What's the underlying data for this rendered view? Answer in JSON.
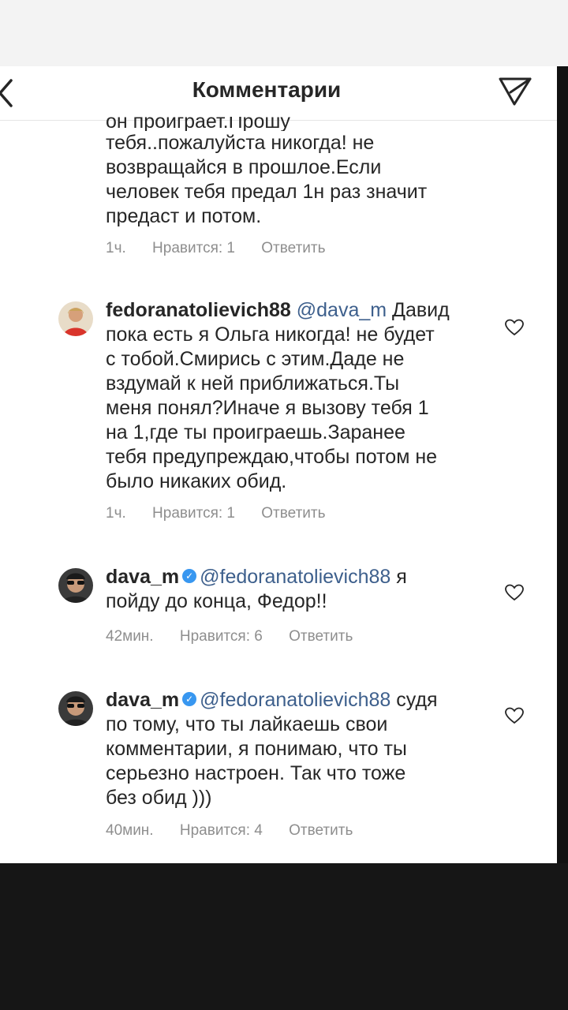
{
  "header": {
    "title": "Комментарии"
  },
  "partial_comment": {
    "cut_line": "он проиграет.Прошу",
    "lines": [
      "тебя..пожалуйста никогда! не",
      "возвращайся в прошлое.Если",
      "человек тебя предал 1н раз значит",
      "предаст и потом."
    ],
    "time": "1ч.",
    "likes": "Нравится: 1",
    "reply": "Ответить"
  },
  "comments": [
    {
      "username": "fedoranatolievich88",
      "mention": "@dava_m",
      "line1_rest": "Давид",
      "lines": [
        "пока есть я Ольга никогда! не будет",
        "с тобой.Смирись с этим.Даде не",
        "вздумай к ней приближаться.Ты",
        "меня понял?Иначе я вызову тебя 1",
        "на 1,где ты проиграешь.Заранее",
        "тебя предупреждаю,чтобы потом не",
        "было никаких обид."
      ],
      "time": "1ч.",
      "likes": "Нравится: 1",
      "reply": "Ответить"
    },
    {
      "username": "dava_m",
      "mention": "@fedoranatolievich88",
      "line1_rest": "я",
      "lines": [
        "пойду до конца, Федор!!"
      ],
      "time": "42мин.",
      "likes": "Нравится: 6",
      "reply": "Ответить"
    },
    {
      "username": "dava_m",
      "mention": "@fedoranatolievich88",
      "line1_rest": "судя",
      "lines": [
        "по тому, что ты лайкаешь свои",
        "комментарии, я понимаю, что ты",
        "серьезно настроен. Так что тоже",
        "без обид )))"
      ],
      "time": "40мин.",
      "likes": "Нравится: 4",
      "reply": "Ответить"
    }
  ],
  "colors": {
    "text": "#262626",
    "meta": "#8e8e8e",
    "mention": "#3d5f8c",
    "verified": "#3897f0"
  }
}
